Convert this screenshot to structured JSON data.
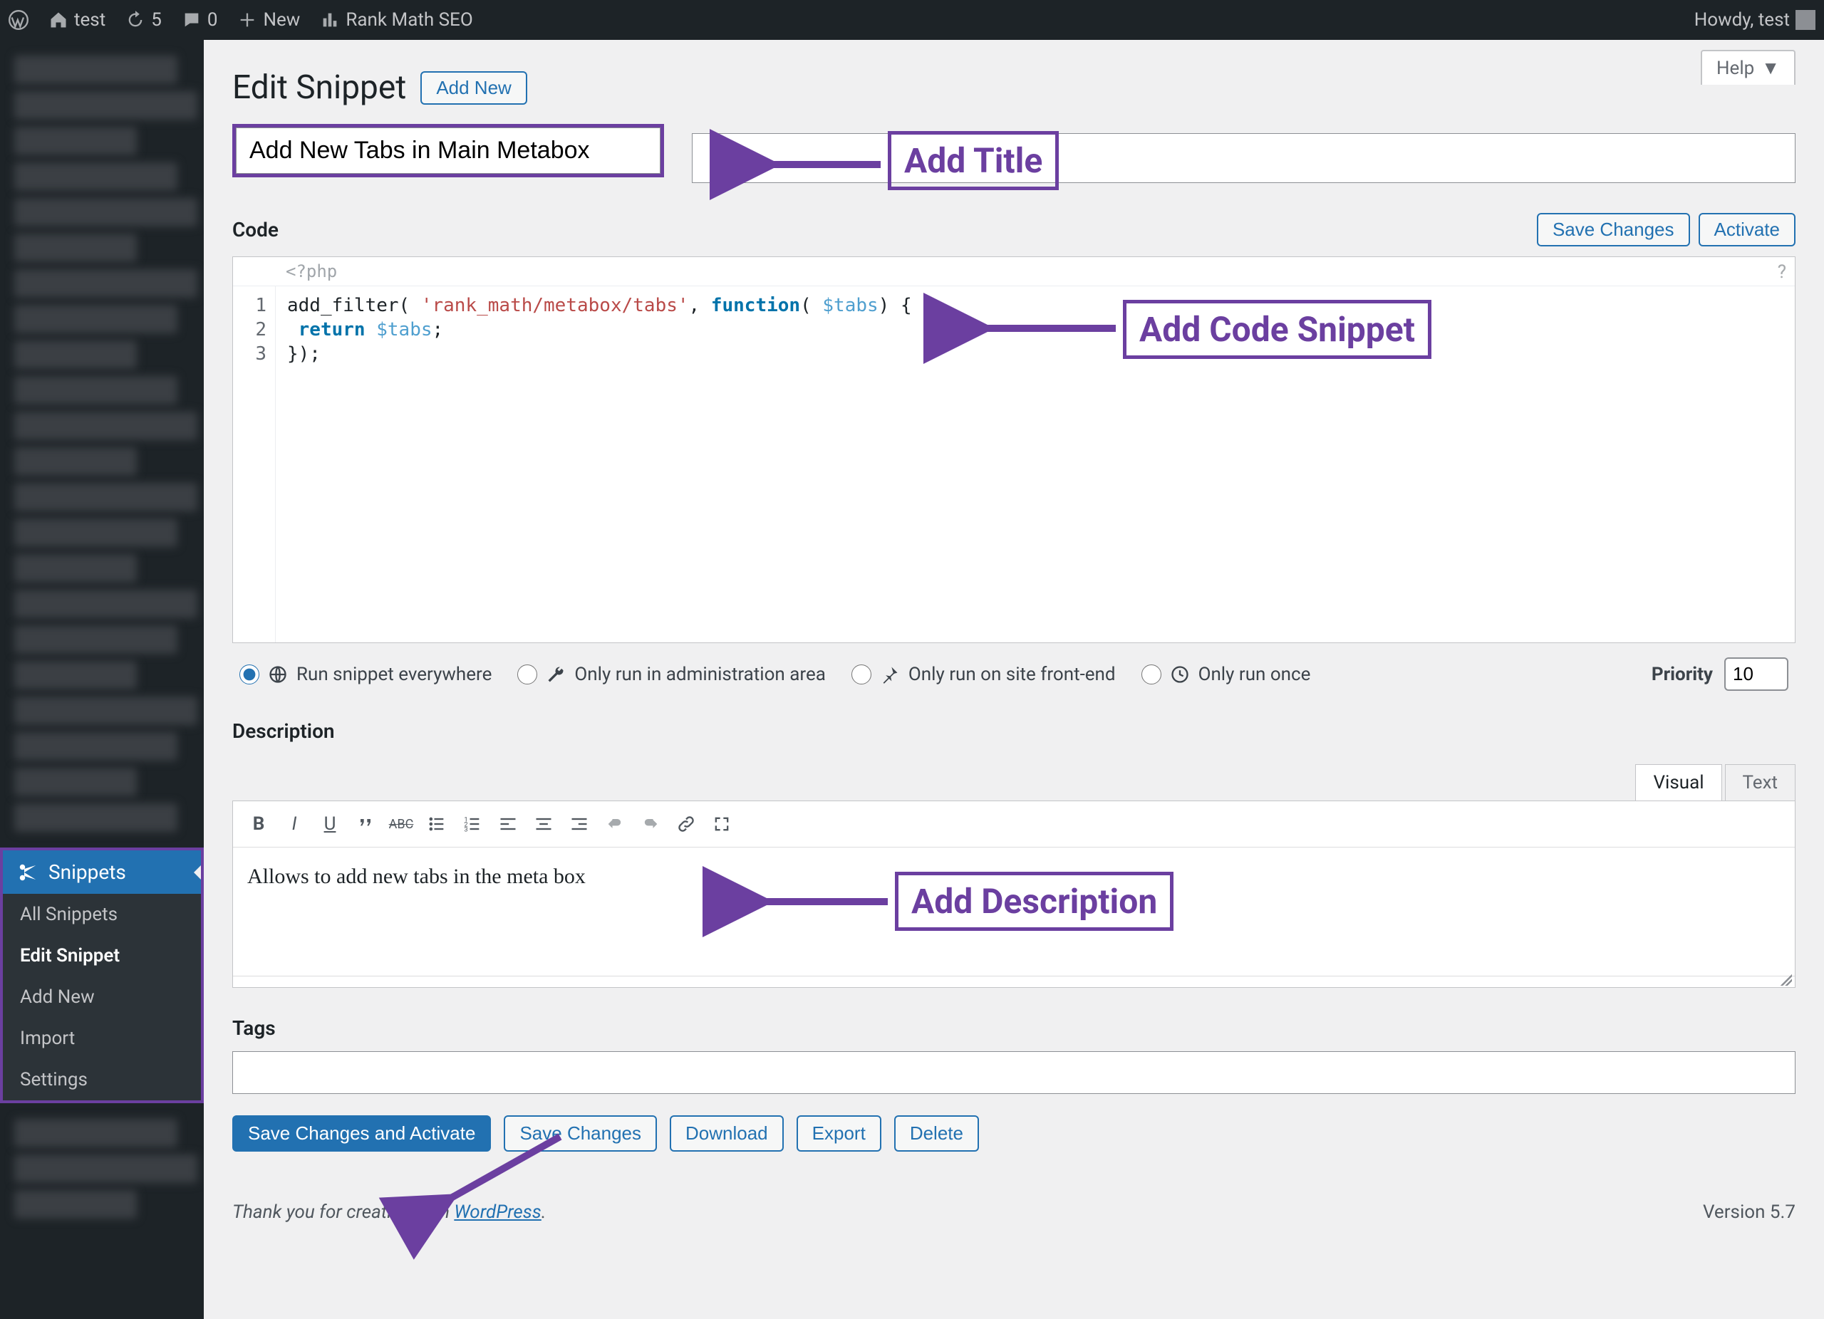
{
  "adminbar": {
    "site": "test",
    "updates": "5",
    "comments": "0",
    "new": "New",
    "rankmath": "Rank Math SEO",
    "howdy": "Howdy, test"
  },
  "sidebar": {
    "snippets": {
      "label": "Snippets",
      "items": [
        {
          "label": "All Snippets",
          "current": false
        },
        {
          "label": "Edit Snippet",
          "current": true
        },
        {
          "label": "Add New",
          "current": false
        },
        {
          "label": "Import",
          "current": false
        },
        {
          "label": "Settings",
          "current": false
        }
      ]
    }
  },
  "page": {
    "help": "Help",
    "heading": "Edit Snippet",
    "add_new": "Add New",
    "title_value": "Add New Tabs in Main Metabox"
  },
  "code_section": {
    "label": "Code",
    "save": "Save Changes",
    "activate": "Activate",
    "prelude": "<?php",
    "lines": [
      "add_filter( 'rank_math/metabox/tabs', function( $tabs) {",
      " return $tabs;",
      "});"
    ]
  },
  "run": {
    "opts": [
      {
        "label": "Run snippet everywhere",
        "checked": true
      },
      {
        "label": "Only run in administration area",
        "checked": false
      },
      {
        "label": "Only run on site front-end",
        "checked": false
      },
      {
        "label": "Only run once",
        "checked": false
      }
    ],
    "priority_label": "Priority",
    "priority_value": "10"
  },
  "desc": {
    "heading": "Description",
    "tabs": {
      "visual": "Visual",
      "text": "Text"
    },
    "body": "Allows to add new tabs in the meta box"
  },
  "tags": {
    "heading": "Tags"
  },
  "actions": {
    "save_activate": "Save Changes and Activate",
    "save": "Save Changes",
    "download": "Download",
    "export": "Export",
    "delete": "Delete"
  },
  "footer": {
    "thanks_pre": "Thank you for creating with ",
    "wp": "WordPress",
    "thanks_post": ".",
    "version": "Version 5.7"
  },
  "callouts": {
    "title": "Add Title",
    "code": "Add Code Snippet",
    "desc": "Add Description"
  }
}
